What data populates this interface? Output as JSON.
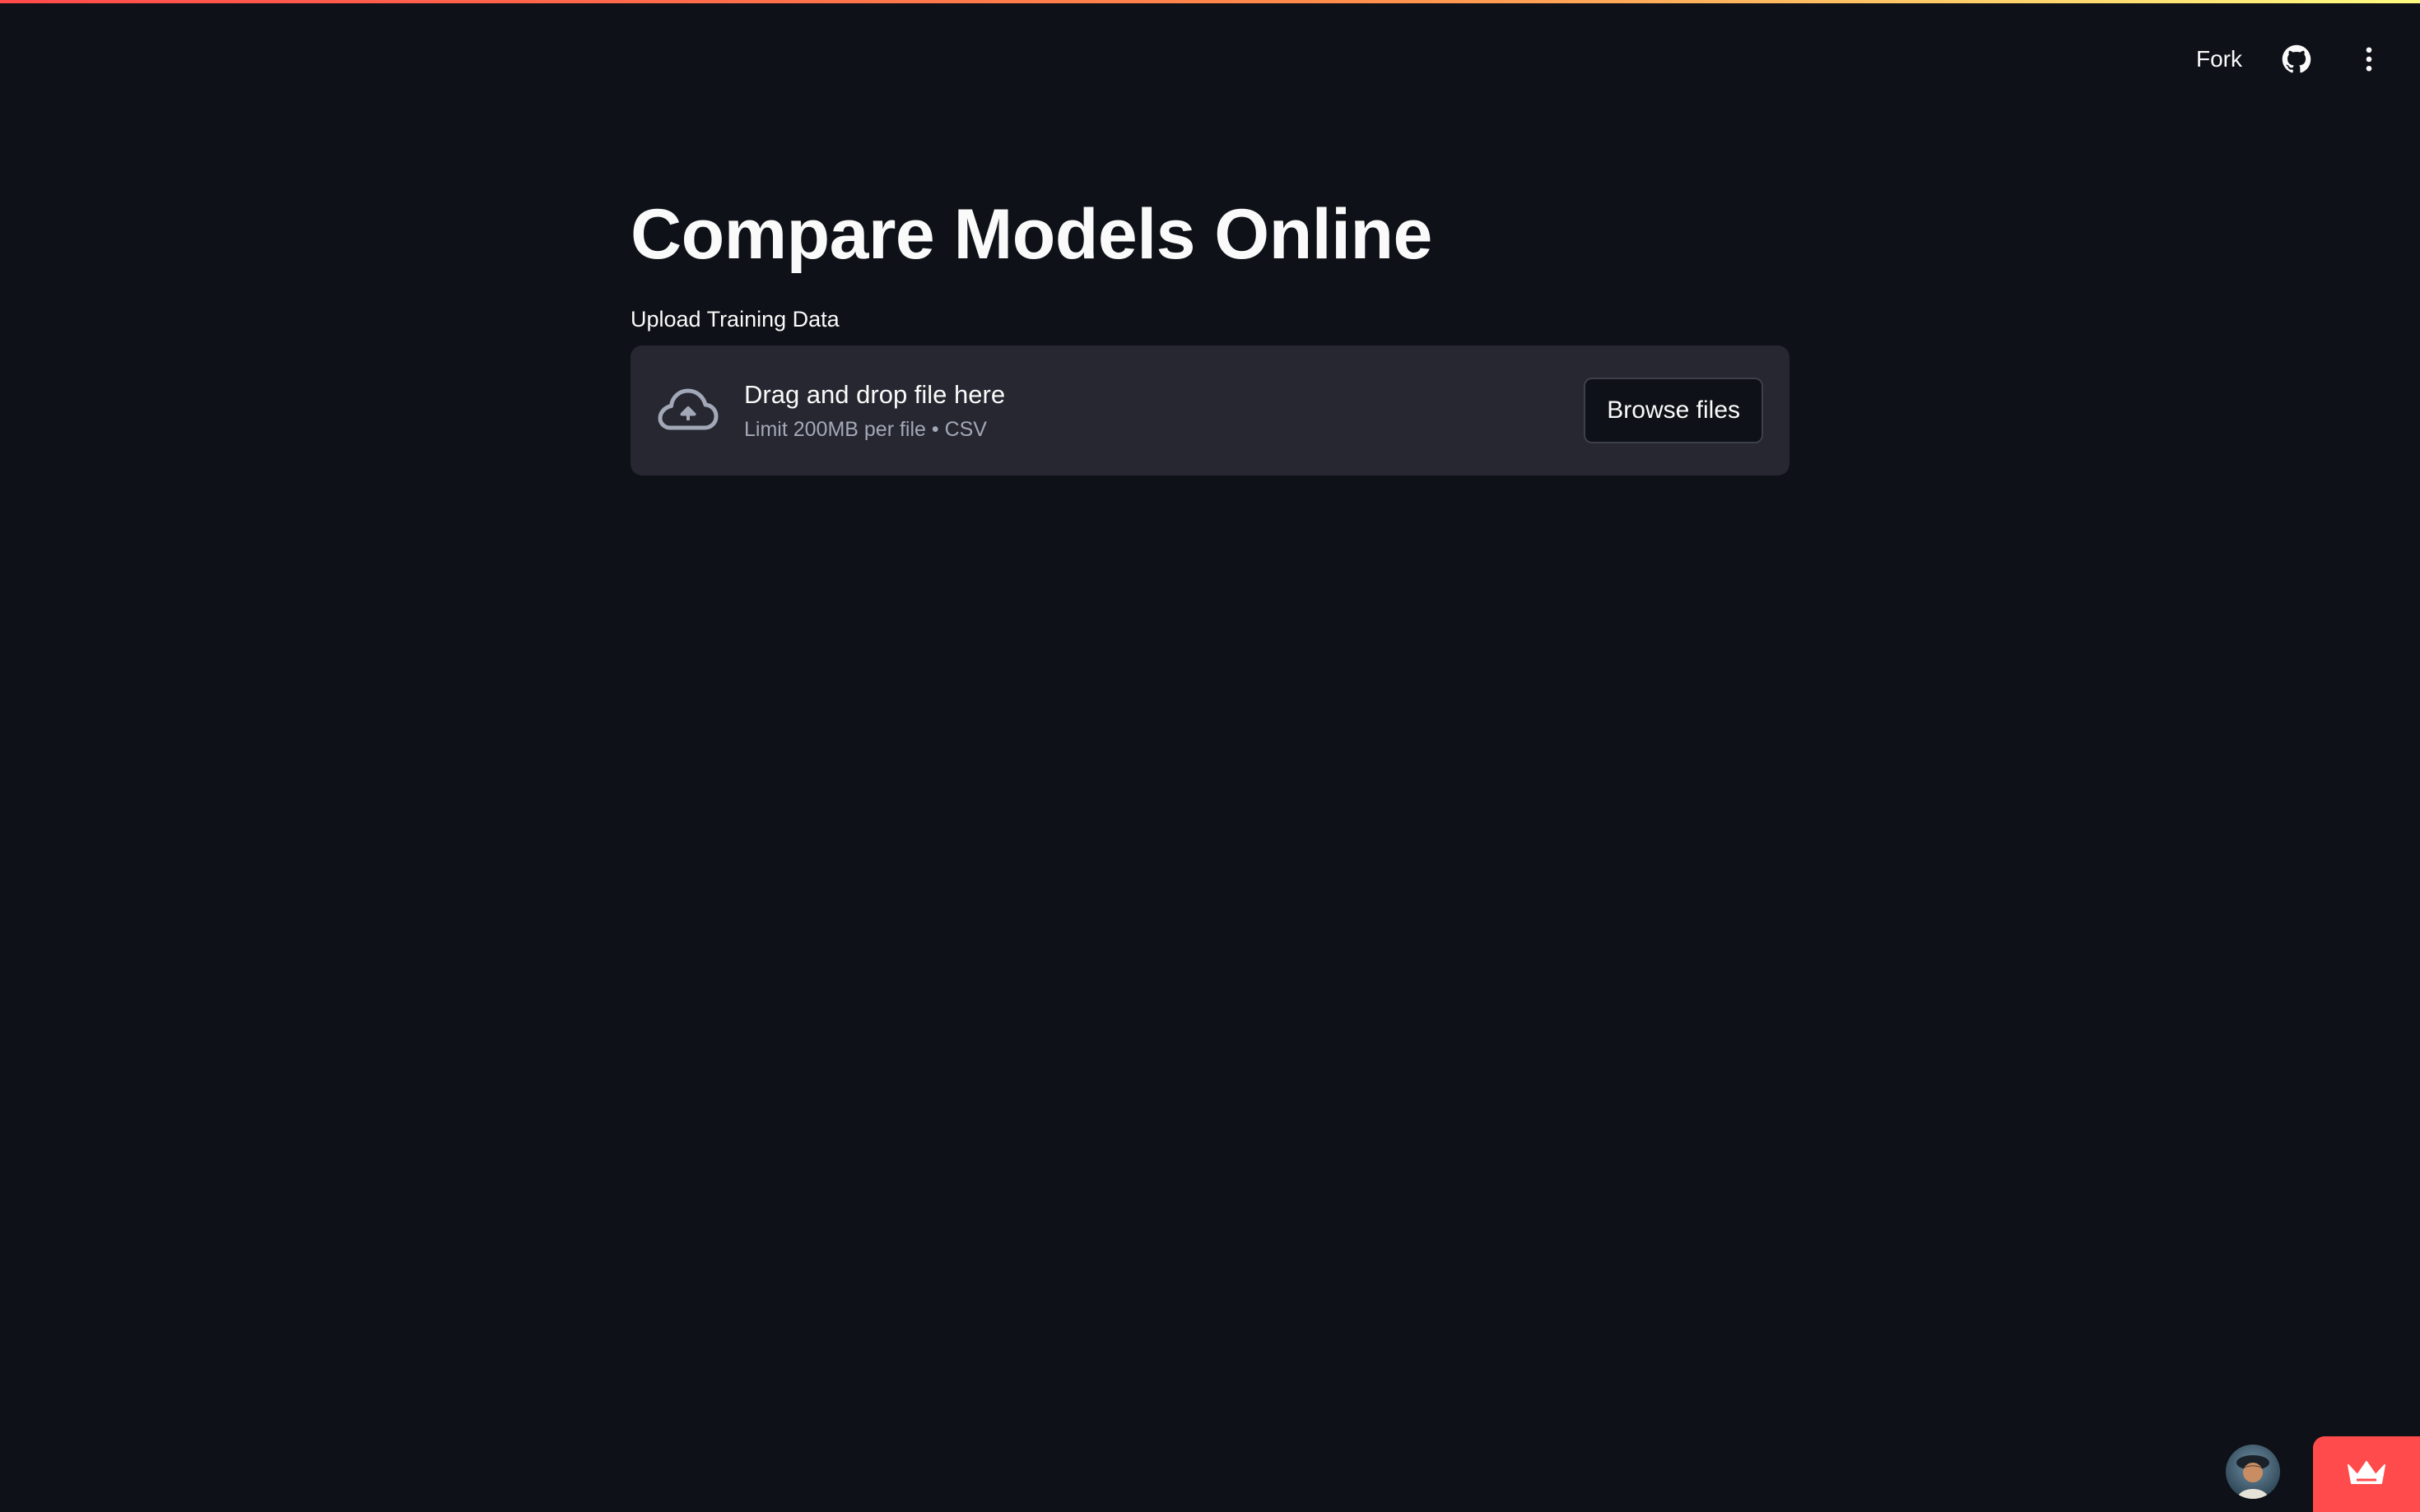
{
  "header": {
    "fork_label": "Fork",
    "icons": [
      "github-icon",
      "more-vertical-icon"
    ]
  },
  "main": {
    "title": "Compare Models Online",
    "uploader": {
      "label": "Upload Training Data",
      "drop_text": "Drag and drop file here",
      "limit_text": "Limit 200MB per file • CSV",
      "browse_label": "Browse files"
    }
  },
  "footer": {
    "icons": [
      "avatar",
      "crown-icon"
    ]
  },
  "colors": {
    "background": "#0e1117",
    "dropzone": "#262730",
    "accent": "#ff4b4b",
    "text": "#fafafa",
    "muted_text": "#a3a8b8"
  }
}
